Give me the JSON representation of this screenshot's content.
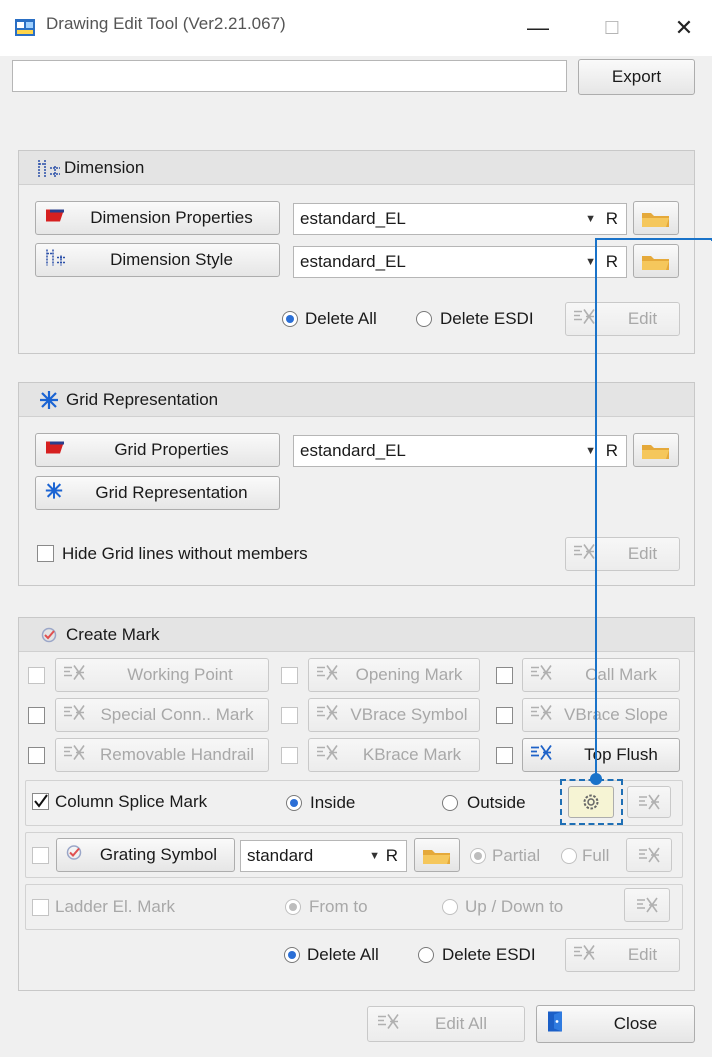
{
  "window": {
    "title": "Drawing Edit Tool (Ver2.21.067)",
    "minimize_glyph": "—",
    "maximize_glyph": "☐",
    "close_glyph": "✕"
  },
  "top": {
    "path_value": "",
    "export_label": "Export"
  },
  "dimension": {
    "header": "Dimension",
    "properties_label": "Dimension Properties",
    "properties_value": "estandard_EL",
    "style_label": "Dimension Style",
    "style_value": "estandard_EL",
    "r_label": "R",
    "delete_all_label": "Delete All",
    "delete_esdi_label": "Delete ESDI",
    "edit_label": "Edit",
    "delete_selected": "Delete All"
  },
  "grid": {
    "header": "Grid Representation",
    "properties_label": "Grid Properties",
    "properties_value": "estandard_EL",
    "r_label": "R",
    "representation_label": "Grid Representation",
    "hide_label": "Hide Grid lines without members",
    "edit_label": "Edit"
  },
  "mark": {
    "header": "Create Mark",
    "working_point": "Working Point",
    "opening_mark": "Opening Mark",
    "call_mark": "Call Mark",
    "special_conn": "Special Conn.. Mark",
    "vbrace_symbol": "VBrace Symbol",
    "vbrace_slope": "VBrace Slope",
    "removable_handrail": "Removable Handrail",
    "kbrace_mark": "KBrace Mark",
    "top_flush": "Top Flush",
    "column_splice": "Column Splice Mark",
    "column_splice_checked": true,
    "inside_label": "Inside",
    "outside_label": "Outside",
    "splice_position": "Inside",
    "grating_label": "Grating Symbol",
    "grating_value": "standard",
    "r_label": "R",
    "partial_label": "Partial",
    "full_label": "Full",
    "ladder_label": "Ladder El. Mark",
    "from_to_label": "From to",
    "up_down_label": "Up / Down to",
    "delete_all_label": "Delete All",
    "delete_esdi_label": "Delete ESDI",
    "edit_label": "Edit"
  },
  "footer": {
    "edit_all_label": "Edit All",
    "close_label": "Close"
  },
  "colors": {
    "accent": "#1a73c9",
    "highlight_border": "#1f6fb5"
  }
}
